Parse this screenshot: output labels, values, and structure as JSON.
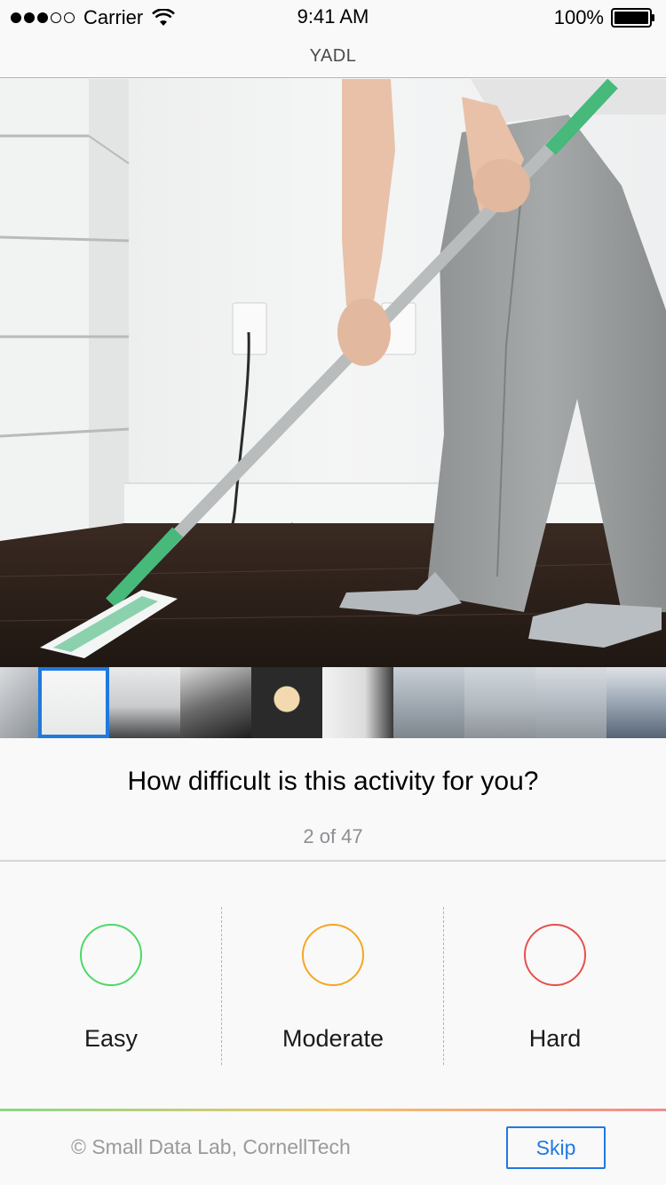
{
  "status_bar": {
    "carrier": "Carrier",
    "time": "9:41 AM",
    "battery": "100%",
    "signal_filled": 3,
    "signal_total": 5
  },
  "nav": {
    "title": "YADL"
  },
  "hero": {
    "icon": "photo-mopping-floor"
  },
  "thumbnails": [
    {
      "name": "thumb-laundry",
      "selected": false
    },
    {
      "name": "thumb-mopping",
      "selected": true
    },
    {
      "name": "thumb-bed",
      "selected": false
    },
    {
      "name": "thumb-cooking",
      "selected": false
    },
    {
      "name": "thumb-tea",
      "selected": false
    },
    {
      "name": "thumb-laptop-bag",
      "selected": false
    },
    {
      "name": "thumb-walking-street",
      "selected": false
    },
    {
      "name": "thumb-walking-dog",
      "selected": false
    },
    {
      "name": "thumb-walking-man",
      "selected": false
    },
    {
      "name": "thumb-cycling",
      "selected": false
    }
  ],
  "question": {
    "text": "How difficult is this activity for you?",
    "progress": "2 of 47"
  },
  "options": [
    {
      "label": "Easy",
      "color": "#4cd964"
    },
    {
      "label": "Moderate",
      "color": "#f5a623"
    },
    {
      "label": "Hard",
      "color": "#e8504a"
    }
  ],
  "footer": {
    "copyright": "© Small Data Lab, CornellTech",
    "skip_label": "Skip"
  },
  "colors": {
    "accent": "#1f7ae0",
    "easy": "#4cd964",
    "moderate": "#f5a623",
    "hard": "#e8504a"
  }
}
